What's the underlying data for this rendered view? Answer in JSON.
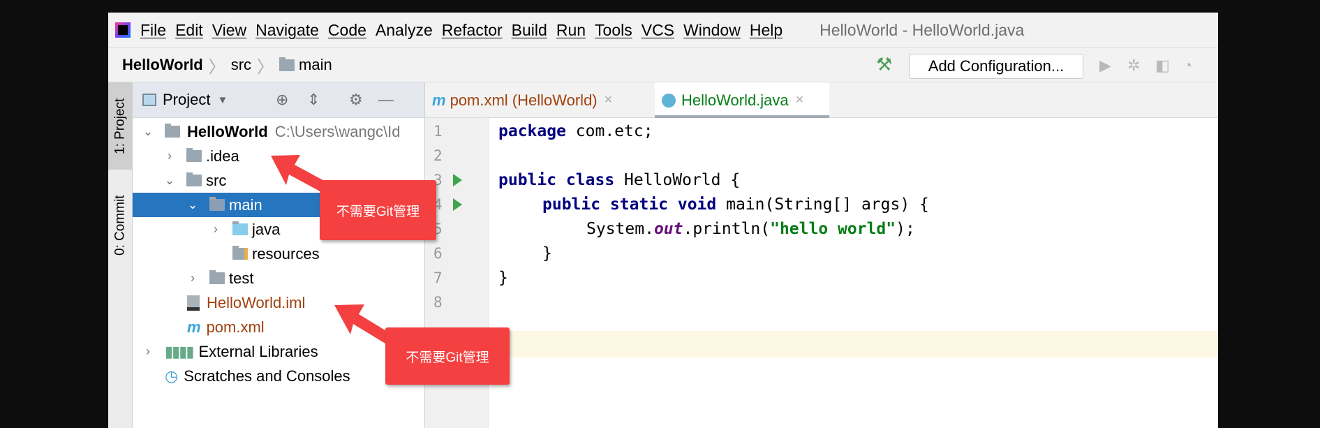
{
  "menubar": {
    "items": [
      "File",
      "Edit",
      "View",
      "Navigate",
      "Code",
      "Analyze",
      "Refactor",
      "Build",
      "Run",
      "Tools",
      "VCS",
      "Window",
      "Help"
    ],
    "title": "HelloWorld - HelloWorld.java"
  },
  "navbar": {
    "crumbs": [
      "HelloWorld",
      "src",
      "main"
    ],
    "add_configuration": "Add Configuration..."
  },
  "stripe": {
    "project_tab": "1: Project",
    "commit_tab": "0: Commit"
  },
  "project": {
    "header": "Project",
    "tree": [
      {
        "label": "HelloWorld",
        "path": "C:\\Users\\wangc\\Id"
      },
      {
        "label": ".idea"
      },
      {
        "label": "src"
      },
      {
        "label": "main"
      },
      {
        "label": "java"
      },
      {
        "label": "resources"
      },
      {
        "label": "test"
      },
      {
        "label": "HelloWorld.iml"
      },
      {
        "label": "pom.xml"
      },
      {
        "label": "External Libraries"
      },
      {
        "label": "Scratches and Consoles"
      }
    ]
  },
  "editor": {
    "tabs": [
      {
        "label": "pom.xml (HelloWorld)"
      },
      {
        "label": "HelloWorld.java"
      }
    ],
    "line_numbers": [
      "1",
      "2",
      "3",
      "4",
      "5",
      "6",
      "7",
      "8"
    ],
    "code": {
      "l1a": "package",
      "l1b": " com.etc;",
      "l3a": "public class",
      "l3b": " HelloWorld {",
      "l4a": "public static void",
      "l4b": " main(String[] args) {",
      "l5a": "System.",
      "l5b": "out",
      "l5c": ".println(",
      "l5d": "\"hello world\"",
      "l5e": ");",
      "l6": "}",
      "l7": "}"
    }
  },
  "annotations": [
    "不需要Git管理",
    "不需要Git管理"
  ],
  "colors": {
    "selection": "#2675bf",
    "callout": "#f44040",
    "string": "#067d17",
    "keyword": "#000080"
  }
}
